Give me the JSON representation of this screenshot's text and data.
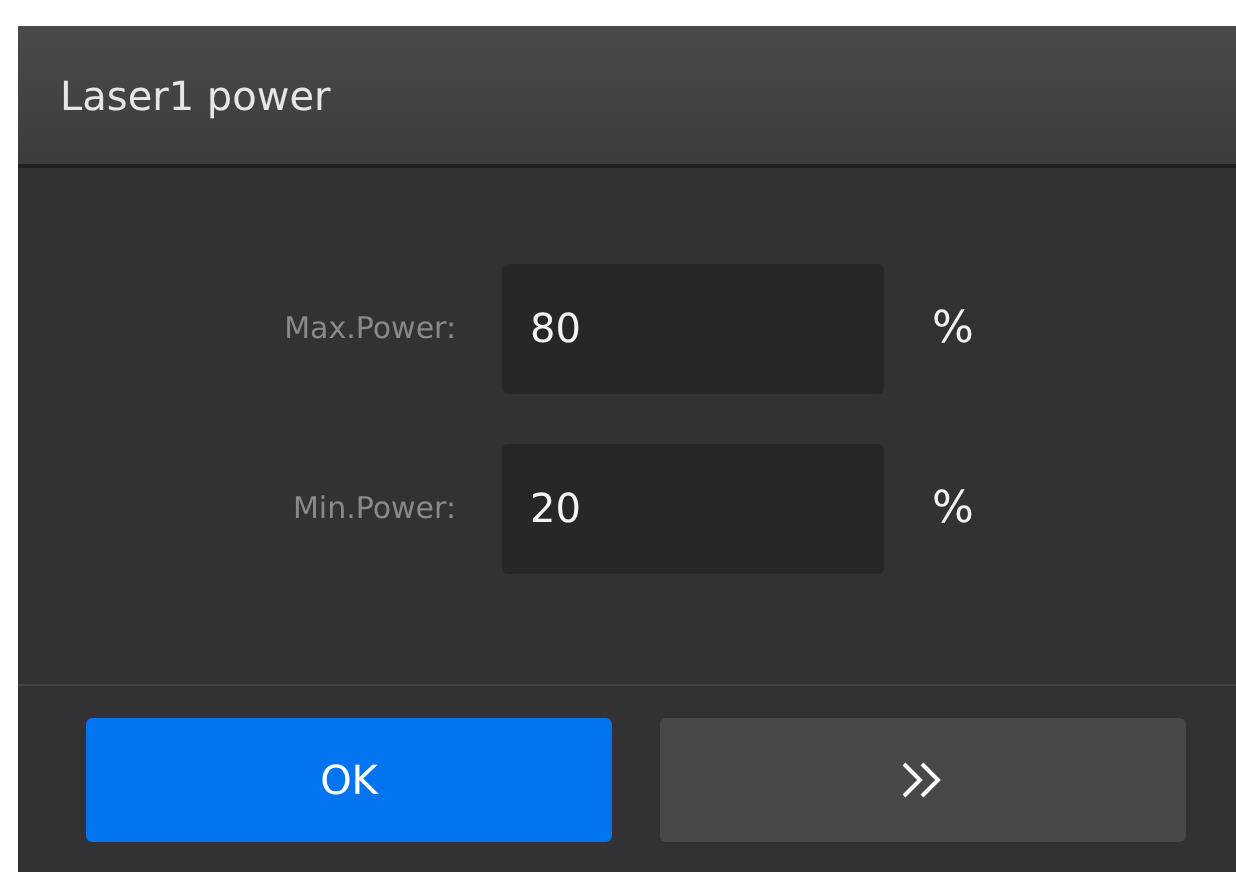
{
  "window": {
    "title": "Laser1 power"
  },
  "fields": [
    {
      "label": "Max.Power:",
      "value": "80",
      "unit": "%"
    },
    {
      "label": "Min.Power:",
      "value": "20",
      "unit": "%"
    }
  ],
  "buttons": [
    {
      "kind": "primary",
      "label": "OK"
    },
    {
      "kind": "next"
    }
  ]
}
